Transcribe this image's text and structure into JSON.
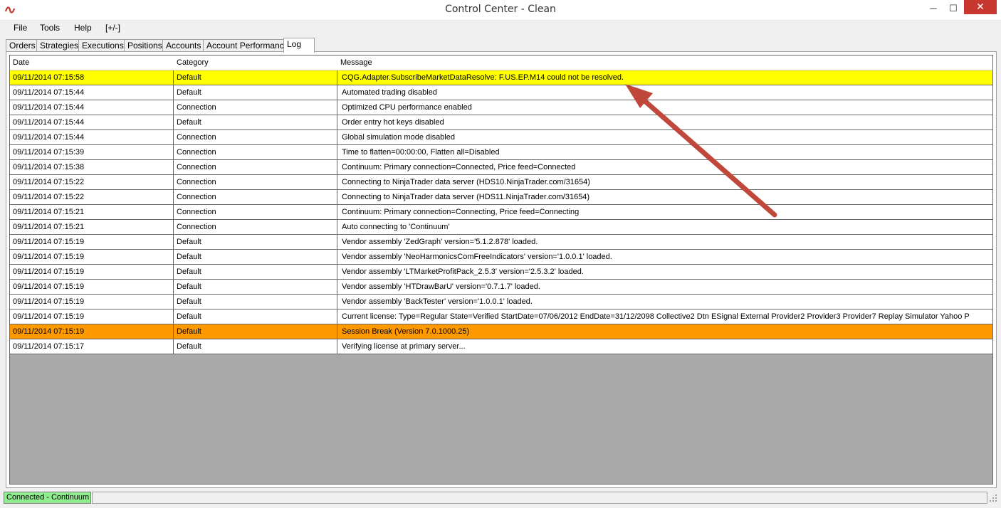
{
  "window": {
    "title": "Control Center - Clean",
    "minimize_label": "─",
    "maximize_label": "☐",
    "close_label": "✕"
  },
  "menu": [
    {
      "label": "File"
    },
    {
      "label": "Tools"
    },
    {
      "label": "Help"
    },
    {
      "label": "[+/-]"
    }
  ],
  "tabs": [
    {
      "label": "Orders"
    },
    {
      "label": "Strategies"
    },
    {
      "label": "Executions"
    },
    {
      "label": "Positions"
    },
    {
      "label": "Accounts"
    },
    {
      "label": "Account Performance"
    },
    {
      "label": "Log",
      "active": true
    }
  ],
  "log": {
    "columns": {
      "date": "Date",
      "category": "Category",
      "message": "Message"
    },
    "rows": [
      {
        "date": "09/11/2014 07:15:58",
        "category": "Default",
        "message": "CQG.Adapter.SubscribeMarketDataResolve:  F.US.EP.M14  could  not  be  resolved.",
        "highlight": "#ffff00"
      },
      {
        "date": "09/11/2014 07:15:44",
        "category": "Default",
        "message": "Automated trading disabled"
      },
      {
        "date": "09/11/2014 07:15:44",
        "category": "Connection",
        "message": "Optimized CPU performance enabled"
      },
      {
        "date": "09/11/2014 07:15:44",
        "category": "Default",
        "message": "Order entry hot keys disabled"
      },
      {
        "date": "09/11/2014 07:15:44",
        "category": "Connection",
        "message": "Global simulation mode disabled"
      },
      {
        "date": "09/11/2014 07:15:39",
        "category": "Connection",
        "message": "Time to flatten=00:00:00, Flatten all=Disabled"
      },
      {
        "date": "09/11/2014 07:15:38",
        "category": "Connection",
        "message": "Continuum: Primary connection=Connected, Price feed=Connected"
      },
      {
        "date": "09/11/2014 07:15:22",
        "category": "Connection",
        "message": "Connecting to NinjaTrader data server (HDS10.NinjaTrader.com/31654)"
      },
      {
        "date": "09/11/2014 07:15:22",
        "category": "Connection",
        "message": "Connecting to NinjaTrader data server (HDS11.NinjaTrader.com/31654)"
      },
      {
        "date": "09/11/2014 07:15:21",
        "category": "Connection",
        "message": "Continuum: Primary connection=Connecting, Price feed=Connecting"
      },
      {
        "date": "09/11/2014 07:15:21",
        "category": "Connection",
        "message": "Auto connecting to 'Continuum'"
      },
      {
        "date": "09/11/2014 07:15:19",
        "category": "Default",
        "message": "Vendor assembly 'ZedGraph' version='5.1.2.878' loaded."
      },
      {
        "date": "09/11/2014 07:15:19",
        "category": "Default",
        "message": "Vendor assembly 'NeoHarmonicsComFreeIndicators' version='1.0.0.1' loaded."
      },
      {
        "date": "09/11/2014 07:15:19",
        "category": "Default",
        "message": "Vendor assembly 'LTMarketProfitPack_2.5.3' version='2.5.3.2' loaded."
      },
      {
        "date": "09/11/2014 07:15:19",
        "category": "Default",
        "message": "Vendor assembly 'HTDrawBarU' version='0.7.1.7' loaded."
      },
      {
        "date": "09/11/2014 07:15:19",
        "category": "Default",
        "message": "Vendor assembly 'BackTester' version='1.0.0.1' loaded."
      },
      {
        "date": "09/11/2014 07:15:19",
        "category": "Default",
        "message": "Current license: Type=Regular State=Verified StartDate=07/06/2012 EndDate=31/12/2098 Collective2 Dtn ESignal External Provider2 Provider3 Provider7 Replay Simulator Yahoo P"
      },
      {
        "date": "09/11/2014 07:15:19",
        "category": "Default",
        "message": "Session Break (Version 7.0.1000.25)",
        "highlight": "#ff9900"
      },
      {
        "date": "09/11/2014 07:15:17",
        "category": "Default",
        "message": "Verifying license at primary server..."
      }
    ]
  },
  "status": {
    "connection": "Connected - Continuum",
    "connection_color": "#90ee90"
  },
  "annotation": {
    "color": "#c0483a",
    "icon": "arrow-annotation"
  }
}
